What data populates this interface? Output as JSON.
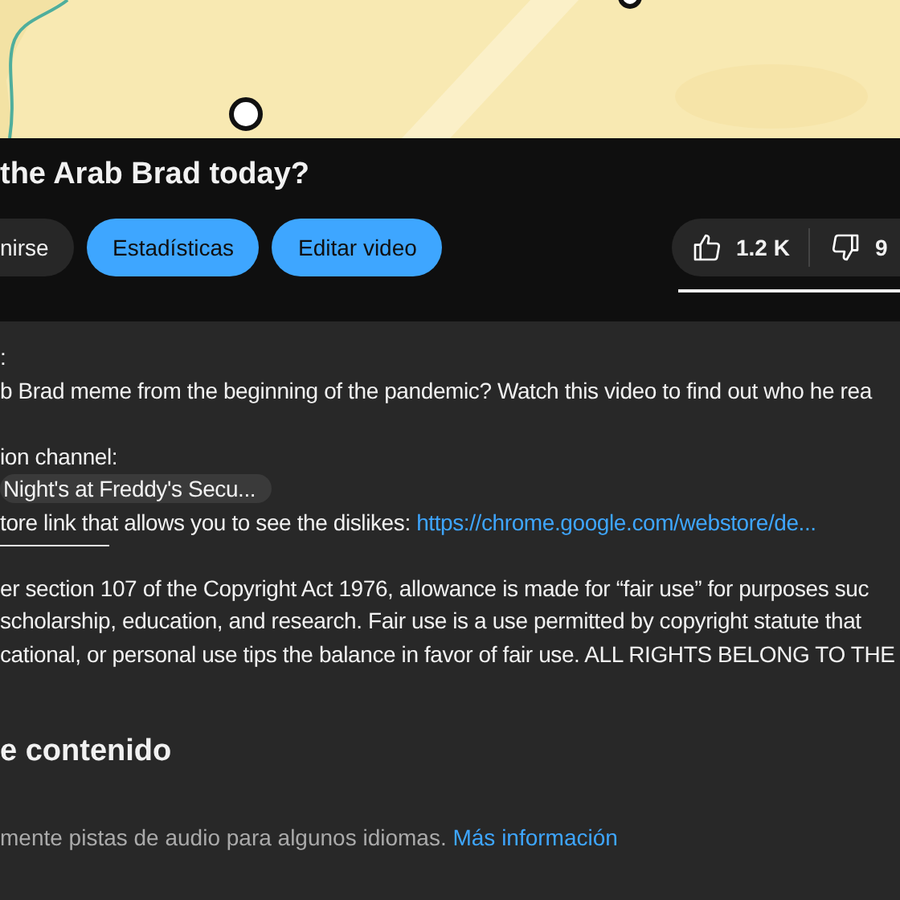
{
  "title": "the Arab Brad today?",
  "actions": [
    {
      "label": "nirse",
      "kind": "plain"
    },
    {
      "label": "Estadísticas",
      "kind": "primary"
    },
    {
      "label": "Editar video",
      "kind": "primary"
    }
  ],
  "likes": {
    "like_count": "1.2 K",
    "dislike_count": "9"
  },
  "description": {
    "lines": [
      {
        "kind": "text",
        "text": ":"
      },
      {
        "kind": "text",
        "text": "b Brad meme from the beginning of the pandemic? Watch this video to find out who he rea"
      },
      {
        "kind": "blank"
      },
      {
        "kind": "text",
        "text": "ion channel:"
      },
      {
        "kind": "chip",
        "text": "Night's at Freddy's Secu..."
      },
      {
        "kind": "link",
        "text": "tore link that allows you to see the dislikes: ",
        "link": "https://chrome.google.com/webstore/de..."
      },
      {
        "kind": "rule"
      },
      {
        "kind": "text",
        "text": "er section 107 of the Copyright Act 1976, allowance is made for “fair use” for purposes suc"
      },
      {
        "kind": "text",
        "text": "scholarship, education, and research. Fair use is a use permitted by copyright statute that"
      },
      {
        "kind": "text",
        "text": "cational, or personal use tips the balance in favor of fair use. ALL RIGHTS BELONG TO THE"
      }
    ]
  },
  "section": {
    "heading": "e contenido",
    "note": "mente pistas de audio para algunos idiomas. ",
    "link": "Más información"
  }
}
